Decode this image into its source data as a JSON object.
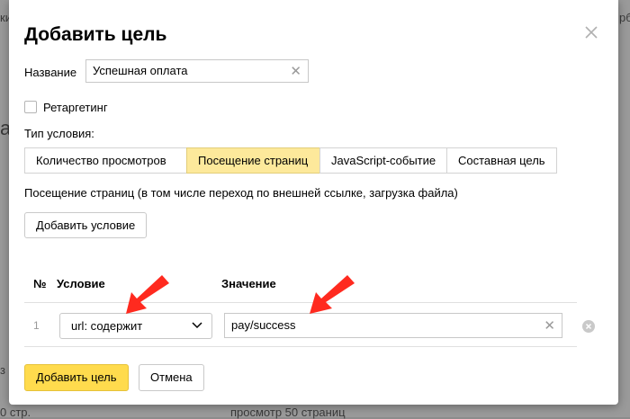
{
  "background": {
    "fragments": [
      "ки",
      "а",
      "рб",
      "з",
      "0 стр.",
      "просмотр 50 страниц"
    ]
  },
  "dialog": {
    "title": "Добавить цель",
    "name_label": "Название",
    "name_value": "Успешная оплата",
    "retargeting_label": "Ретаргетинг",
    "retargeting_checked": false,
    "condition_type_label": "Тип условия:",
    "tabs": [
      {
        "label": "Количество просмотров",
        "active": false
      },
      {
        "label": "Посещение страниц",
        "active": true
      },
      {
        "label": "JavaScript-событие",
        "active": false
      },
      {
        "label": "Составная цель",
        "active": false
      }
    ],
    "description": "Посещение страниц (в том числе переход по внешней ссылке, загрузка файла)",
    "add_condition_label": "Добавить условие",
    "table": {
      "col_num": "№",
      "col_condition": "Условие",
      "col_value": "Значение",
      "rows": [
        {
          "num": "1",
          "condition": "url: содержит",
          "value": "pay/success"
        }
      ]
    },
    "submit_label": "Добавить цель",
    "cancel_label": "Отмена"
  },
  "colors": {
    "accent_yellow": "#ffdb4d",
    "active_tab": "#fde99b",
    "annotation_arrow": "#ff2a1f"
  }
}
